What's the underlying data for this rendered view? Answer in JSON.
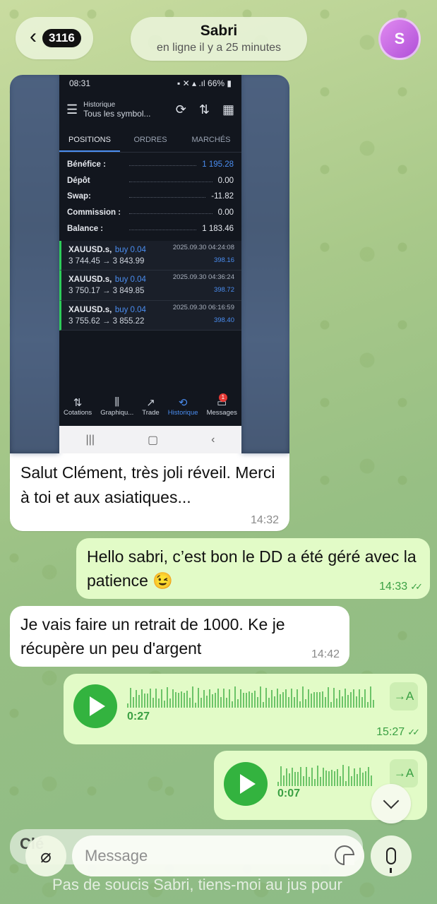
{
  "header": {
    "back_count": "3116",
    "contact_name": "Sabri",
    "status": "en ligne il y a 25 minutes",
    "avatar_letter": "S",
    "avatar_color": "#c66de6"
  },
  "screenshot": {
    "status_time": "08:31",
    "status_battery": "66%",
    "app_title": "Historique",
    "app_subtitle": "Tous les symbol...",
    "tabs": [
      "POSITIONS",
      "ORDRES",
      "MARCHÉS"
    ],
    "summary": [
      {
        "label": "Bénéfice :",
        "value": "1 195.28"
      },
      {
        "label": "Dépôt",
        "value": "0.00"
      },
      {
        "label": "Swap:",
        "value": "-11.82"
      },
      {
        "label": "Commission :",
        "value": "0.00"
      },
      {
        "label": "Balance :",
        "value": "1 183.46"
      }
    ],
    "trades": [
      {
        "symbol": "XAUUSD.s,",
        "side": "buy 0.04",
        "prices": "3 744.45 → 3 843.99",
        "date": "2025.09.30 04:24:08",
        "profit": "398.16"
      },
      {
        "symbol": "XAUUSD.s,",
        "side": "buy 0.04",
        "prices": "3 750.17 → 3 849.85",
        "date": "2025.09.30 04:36:24",
        "profit": "398.72"
      },
      {
        "symbol": "XAUUSD.s,",
        "side": "buy 0.04",
        "prices": "3 755.62 → 3 855.22",
        "date": "2025.09.30 06:16:59",
        "profit": "398.40"
      }
    ],
    "nav": [
      "Cotations",
      "Graphiqu...",
      "Trade",
      "Historique",
      "Messages"
    ],
    "messages_badge": "1"
  },
  "messages": [
    {
      "caption": "Salut Clément, très joli réveil. Merci à toi et aux asiatiques...",
      "time": "14:32"
    },
    {
      "text": "Hello sabri, c’est bon le DD a été géré avec la patience 😉",
      "time": "14:33"
    },
    {
      "text": "Je vais faire un retrait de 1000. Ke je récupère un peu d'argent",
      "time": "14:42"
    },
    {
      "voice_duration": "0:27",
      "time": "15:27"
    },
    {
      "voice_duration": "0:07"
    }
  ],
  "transcribe_label": "→A",
  "composer": {
    "placeholder": "Message",
    "reply_preview": "Clé",
    "draft_text": "Pas de soucis Sabri, tiens-moi au jus pour"
  }
}
